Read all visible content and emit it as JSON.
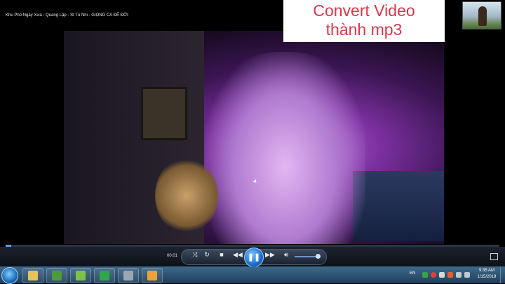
{
  "window": {
    "title": "Khu Phố Ngày Xưa - Quang Lập - St Tú Nhi - GIỌNG CA ĐỂ ĐỜI"
  },
  "overlay": {
    "line1": "Convert Video",
    "line2": "thành  mp3",
    "color": "#e0364a"
  },
  "player": {
    "elapsed": "00:01",
    "progress": 0.012,
    "volume": 0.8,
    "controls": {
      "shuffle_icon": "shuffle-icon",
      "repeat_icon": "repeat-icon",
      "stop_icon": "stop-icon",
      "prev_icon": "previous-icon",
      "play_icon": "pause-icon",
      "next_icon": "next-icon",
      "mute_icon": "speaker-icon"
    },
    "accent": "#5b9ee6"
  },
  "taskbar": {
    "apps": [
      {
        "name": "windows-explorer-icon",
        "color": "#e6c25a"
      },
      {
        "name": "chrome-icon",
        "color": "#4f9a3c"
      },
      {
        "name": "coccoc-icon",
        "color": "#7cc24a"
      },
      {
        "name": "camtasia-icon",
        "color": "#2ea84a"
      },
      {
        "name": "network-app-icon",
        "color": "#9aa6b2"
      },
      {
        "name": "media-player-icon",
        "color": "#f0a23a"
      }
    ],
    "language": "EN",
    "time": "9:35 AM",
    "date": "1/15/2019"
  }
}
